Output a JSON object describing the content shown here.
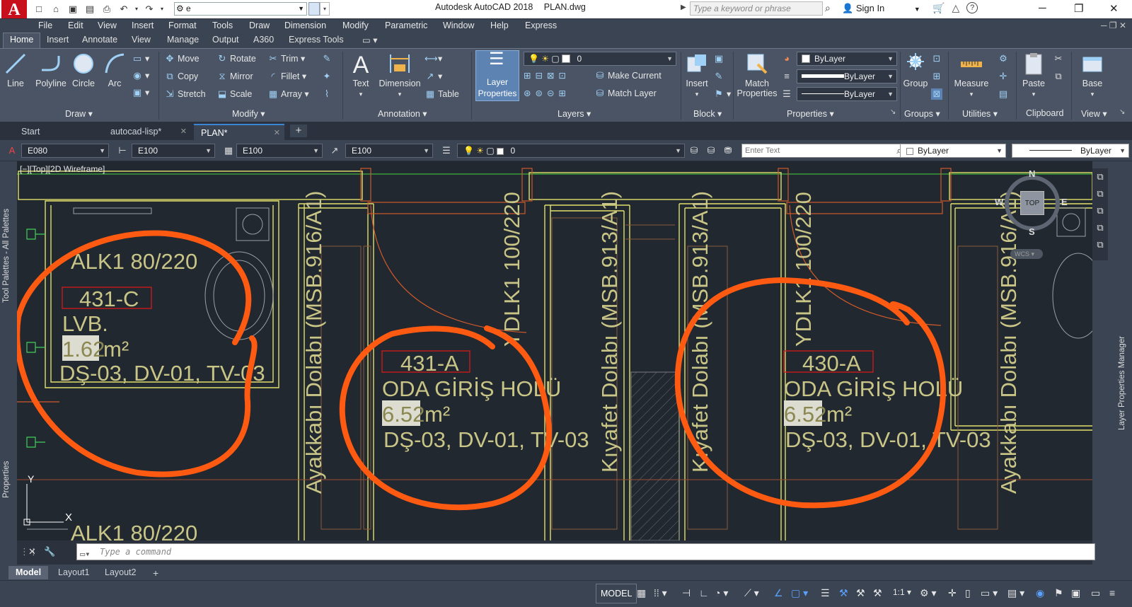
{
  "titlebar": {
    "app_logo": "A",
    "workspace": "e",
    "app_name": "Autodesk AutoCAD 2018",
    "file_name": "PLAN.dwg",
    "search_placeholder": "Type a keyword or phrase",
    "sign_in": "Sign In"
  },
  "menubar": [
    "File",
    "Edit",
    "View",
    "Insert",
    "Format",
    "Tools",
    "Draw",
    "Dimension",
    "Modify",
    "Parametric",
    "Window",
    "Help",
    "Express"
  ],
  "ribbon_tabs": [
    "Home",
    "Insert",
    "Annotate",
    "View",
    "Manage",
    "Output",
    "A360",
    "Express Tools"
  ],
  "ribbon": {
    "draw": {
      "label": "Draw",
      "line": "Line",
      "polyline": "Polyline",
      "circle": "Circle",
      "arc": "Arc"
    },
    "modify": {
      "label": "Modify",
      "move": "Move",
      "rotate": "Rotate",
      "trim": "Trim",
      "copy": "Copy",
      "mirror": "Mirror",
      "fillet": "Fillet",
      "stretch": "Stretch",
      "scale": "Scale",
      "array": "Array"
    },
    "annotation": {
      "label": "Annotation",
      "text": "Text",
      "dimension": "Dimension",
      "table": "Table"
    },
    "layers": {
      "label": "Layers",
      "layer_properties_1": "Layer",
      "layer_properties_2": "Properties",
      "current_layer": "0",
      "make_current": "Make Current",
      "match_layer": "Match Layer"
    },
    "block": {
      "label": "Block",
      "insert": "Insert"
    },
    "properties": {
      "label": "Properties",
      "match_1": "Match",
      "match_2": "Properties",
      "color": "ByLayer",
      "lineweight": "ByLayer",
      "linetype": "ByLayer"
    },
    "groups": {
      "label": "Groups",
      "group": "Group"
    },
    "utilities": {
      "label": "Utilities",
      "measure": "Measure"
    },
    "clipboard": {
      "label": "Clipboard",
      "paste": "Paste"
    },
    "view": {
      "label": "View",
      "base": "Base"
    }
  },
  "file_tabs": {
    "start": "Start",
    "tab1": "autocad-lisp*",
    "tab2": "PLAN*"
  },
  "propbar": {
    "dimstyle": "E080",
    "style2": "E100",
    "style3": "E100",
    "style4": "E100",
    "layer": "0",
    "enter_text": "Enter Text",
    "color": "ByLayer",
    "linetype": "ByLayer"
  },
  "viewport": {
    "label": "[−][Top][2D Wireframe]",
    "compass": {
      "n": "N",
      "s": "S",
      "e": "E",
      "w": "W",
      "top": "TOP",
      "wcs": "WCS"
    },
    "ucs_y": "Y",
    "ucs_x": "X"
  },
  "drawing_text": {
    "alk1": "ALK1 80/220",
    "room1_code": "431-C",
    "room1_name": "LVB.",
    "room1_area": "1.62",
    "room1_unit": "m²",
    "room1_finish": "DŞ-03, DV-01, TV-03",
    "ayakkabi1": "Ayakkabı Dolabı (MSB.916/A1)",
    "room2_code": "431-A",
    "room2_name": "ODA GİRİŞ HOLÜ",
    "room2_area": "6.52",
    "room2_unit": "m²",
    "room2_finish": "DŞ-03, DV-01, TV-03",
    "ydlk1": "YDLK1 100/220",
    "kiyafet1": "Kıyafet Dolabı (MSB.913/A1)",
    "kiyafet2": "Kıyafet Dolabı (MSB.913/A1)",
    "ydlk2": "YDLK1 100/220",
    "room3_code": "430-A",
    "room3_name": "ODA GİRİŞ HOLÜ",
    "room3_area": "6.52",
    "room3_unit": "m²",
    "room3_finish": "DŞ-03, DV-01, TV-03",
    "ayakkabi2": "Ayakkabı Dolabı (MSB.916/A1)",
    "alk1_bottom": "ALK1 80/220"
  },
  "side_palettes": {
    "left_top": "Tool Palettes - All Palettes",
    "left_bottom": "Properties",
    "right": "Layer Properties Manager"
  },
  "cmdline": {
    "placeholder": "Type a command"
  },
  "layout_tabs": [
    "Model",
    "Layout1",
    "Layout2"
  ],
  "status": {
    "model": "MODEL",
    "scale": "1:1"
  },
  "colors": {
    "cad_bg": "#212830",
    "text_yellow": "#c9c586",
    "annotation_orange": "#ff5a12",
    "box_red": "#d51a1a",
    "wall_yellow": "#e2e06a",
    "ui_bg": "#3b4453"
  }
}
